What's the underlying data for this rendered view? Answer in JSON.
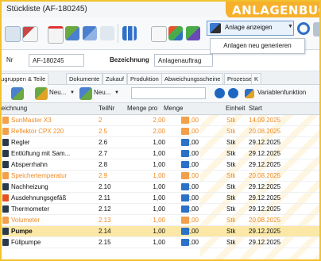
{
  "window": {
    "title": "Stückliste (AF-180245)",
    "badge": "ANLAGENBUCH"
  },
  "toolbar": {
    "anlage_button_label": "Anlage anzeigen",
    "dropdown_item": "Anlagen neu generieren"
  },
  "form": {
    "nr_label": "Nr",
    "nr_value": "AF-180245",
    "bezeichnung_label": "Bezeichnung",
    "bezeichnung_value": "Anlagenauftrag"
  },
  "tabs": [
    {
      "label": "Baugruppen & Teile"
    },
    {
      "label": "Dokumente"
    },
    {
      "label": "Zukauf"
    },
    {
      "label": "Produktion"
    },
    {
      "label": "Abweichungsscheine"
    },
    {
      "label": "Prozesse"
    },
    {
      "label": "K"
    }
  ],
  "subtoolbar": {
    "neu1": "Neu...",
    "neu2": "Neu...",
    "variablen": "Variablenfunktion"
  },
  "grid": {
    "headers": [
      "Bezeichnung",
      "TeilNr",
      "Menge pro",
      "Menge",
      "Einheit",
      "Start"
    ],
    "rows": [
      {
        "name": "SunMaster X3",
        "teilnr": "2",
        "menge_pro": "2,00",
        "menge": "2,00",
        "einheit": "Stk",
        "start": "14.09.2025",
        "style": "orange",
        "icon": "assembly-icon"
      },
      {
        "name": "Reflektor CPX 220",
        "teilnr": "2.5",
        "menge_pro": "2,00",
        "menge": "4,00",
        "einheit": "Stk",
        "start": "20.08.2025",
        "style": "orange",
        "icon": "part-icon"
      },
      {
        "name": "Regler",
        "teilnr": "2.6",
        "menge_pro": "1,00",
        "menge": "2,00",
        "einheit": "Stk",
        "start": "29.12.2025",
        "style": "black",
        "icon": "component-icon"
      },
      {
        "name": "Entlüftung mit Sam...",
        "teilnr": "2.7",
        "menge_pro": "1,00",
        "menge": "2,00",
        "einheit": "Stk",
        "start": "29.12.2025",
        "style": "black",
        "icon": "component-icon"
      },
      {
        "name": "Absperrhahn",
        "teilnr": "2.8",
        "menge_pro": "1,00",
        "menge": "2,00",
        "einheit": "Stk",
        "start": "29.12.2025",
        "style": "black",
        "icon": "component-icon"
      },
      {
        "name": "Speichertemperatur",
        "teilnr": "2.9",
        "menge_pro": "1,00",
        "menge": "2,00",
        "einheit": "Stk",
        "start": "20.08.2025",
        "style": "orange",
        "icon": "part-icon"
      },
      {
        "name": "Nachheizung",
        "teilnr": "2.10",
        "menge_pro": "1,00",
        "menge": "2,00",
        "einheit": "Stk",
        "start": "29.12.2025",
        "style": "black",
        "icon": "component-icon"
      },
      {
        "name": "Ausdehnungsgefäß",
        "teilnr": "2.11",
        "menge_pro": "1,00",
        "menge": "2,00",
        "einheit": "Stk",
        "start": "29.12.2025",
        "style": "black",
        "icon": "part-icon"
      },
      {
        "name": "Thermometer",
        "teilnr": "2.12",
        "menge_pro": "1,00",
        "menge": "2,00",
        "einheit": "Stk",
        "start": "29.12.2025",
        "style": "black",
        "icon": "component-icon"
      },
      {
        "name": "Volumeter",
        "teilnr": "2.13",
        "menge_pro": "1,00",
        "menge": "2,00",
        "einheit": "Stk",
        "start": "20.08.2025",
        "style": "orange",
        "icon": "part-icon"
      },
      {
        "name": "Pumpe",
        "teilnr": "2.14",
        "menge_pro": "1,00",
        "menge": "2,00",
        "einheit": "Stk",
        "start": "29.12.2025",
        "style": "black",
        "icon": "component-icon",
        "selected": true
      },
      {
        "name": "Füllpumpe",
        "teilnr": "2.15",
        "menge_pro": "1,00",
        "menge": "2,00",
        "einheit": "Stk",
        "start": "29.12.2025",
        "style": "black",
        "icon": "component-icon"
      }
    ]
  },
  "colors": {
    "accent_yellow": "#f2c12e",
    "badge": "#f6b02c",
    "orange_text": "#f08a23",
    "selected_row": "#fbe8a6",
    "blue": "#1f66c1"
  }
}
